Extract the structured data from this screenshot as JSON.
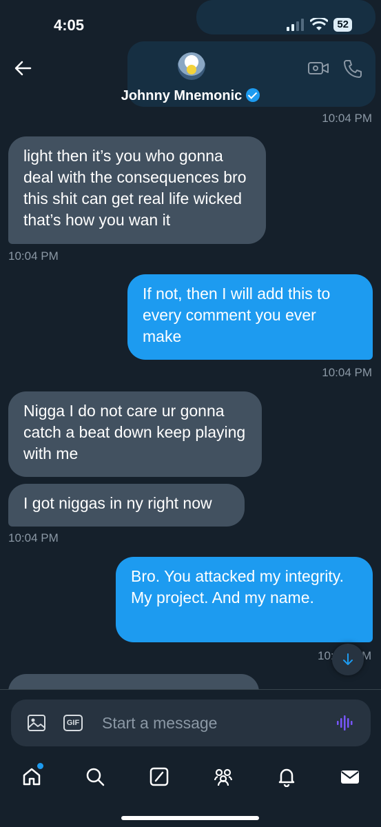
{
  "status_bar": {
    "time": "4:05",
    "battery": "52"
  },
  "header": {
    "contact_name": "Johnny Mnemonic"
  },
  "messages": [
    {
      "direction": "in",
      "text": "light then it’s you who gonna deal with the consequences bro this shit can get real life wicked that’s how you wan it"
    },
    {
      "direction": "out",
      "text": "If not, then I will add this to every comment you ever make"
    },
    {
      "direction": "in",
      "text": "Nigga I do not care ur gonna catch a beat down keep playing with me"
    },
    {
      "direction": "in",
      "text": "I got niggas in ny right now"
    },
    {
      "direction": "out",
      "text": "Bro. You attacked my integrity. My project. And my name."
    }
  ],
  "timestamps": {
    "top": "10:04 PM",
    "after_msg1": "10:04 PM",
    "after_msg2": "10:04 PM",
    "after_msg4": "10:04 PM",
    "after_msg5_left": "10:",
    "after_msg5_right": "M"
  },
  "composer": {
    "placeholder": "Start a message"
  },
  "tabs": [
    "home-icon",
    "search-icon",
    "grok-icon",
    "communities-icon",
    "notifications-icon",
    "messages-icon"
  ],
  "colors": {
    "background": "#15202b",
    "incoming": "#425160",
    "outgoing": "#1d9bf0",
    "accent": "#1d9bf0",
    "timestamp": "#8b98a5"
  }
}
